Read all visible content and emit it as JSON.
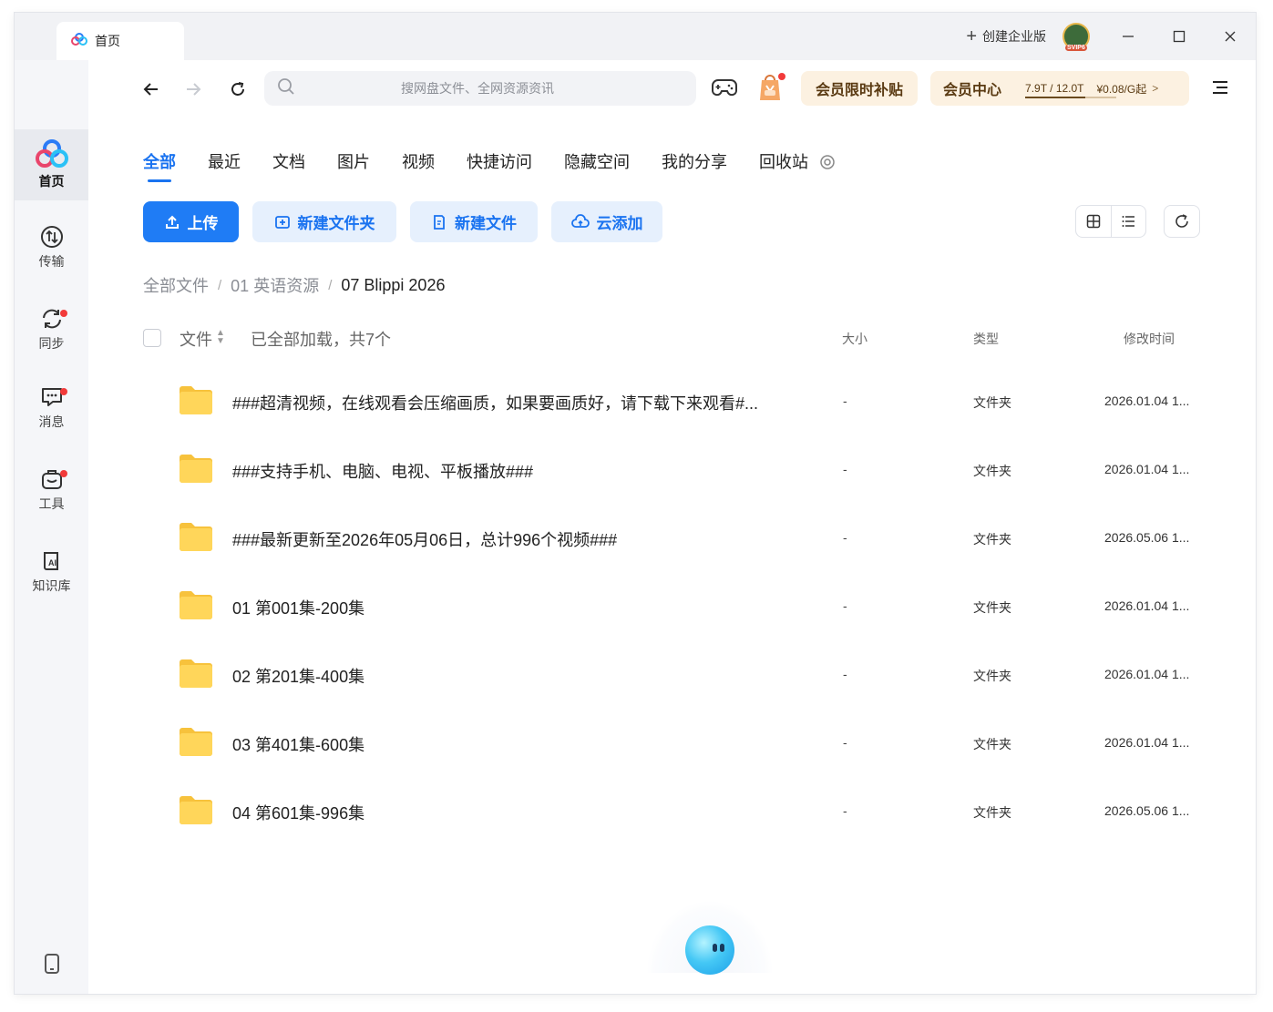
{
  "titlebar": {
    "tab_label": "首页",
    "enterprise_label": "创建企业版",
    "avatar_badge": "SVIP6"
  },
  "sidebar": {
    "items": [
      {
        "label": "首页",
        "icon": "baidu-netdisk-logo-icon",
        "active": true
      },
      {
        "label": "传输",
        "icon": "transfer-icon",
        "badge": false
      },
      {
        "label": "同步",
        "icon": "sync-icon",
        "badge": true
      },
      {
        "label": "消息",
        "icon": "message-icon",
        "badge": true
      },
      {
        "label": "工具",
        "icon": "toolbox-icon",
        "badge": true
      },
      {
        "label": "知识库",
        "icon": "knowledge-base-icon",
        "badge": false
      }
    ]
  },
  "toolbar": {
    "search_placeholder": "搜网盘文件、全网资源资讯",
    "promo_label": "会员限时补贴",
    "vip_label": "会员中心",
    "storage_text": "7.9T / 12.0T",
    "storage_used_fraction": 0.66,
    "price_text": "¥0.08/G起",
    "price_chevron": ">"
  },
  "tabs": [
    "全部",
    "最近",
    "文档",
    "图片",
    "视频",
    "快捷访问",
    "隐藏空间",
    "我的分享",
    "回收站"
  ],
  "actions": {
    "upload": "上传",
    "new_folder": "新建文件夹",
    "new_file": "新建文件",
    "cloud_add": "云添加"
  },
  "breadcrumb": {
    "items": [
      "全部文件",
      "01 英语资源"
    ],
    "current": "07 Blippi 2026",
    "separator": "/"
  },
  "list": {
    "header": {
      "file": "文件",
      "loaded": "已全部加载，共7个",
      "size": "大小",
      "type": "类型",
      "modified": "修改时间"
    },
    "rows": [
      {
        "name": "###超清视频，在线观看会压缩画质，如果要画质好，请下载下来观看#...",
        "size": "-",
        "type": "文件夹",
        "date": "2026.01.04 1..."
      },
      {
        "name": "###支持手机、电脑、电视、平板播放###",
        "size": "-",
        "type": "文件夹",
        "date": "2026.01.04 1..."
      },
      {
        "name": "###最新更新至2026年05月06日，总计996个视频###",
        "size": "-",
        "type": "文件夹",
        "date": "2026.05.06 1..."
      },
      {
        "name": "01 第001集-200集",
        "size": "-",
        "type": "文件夹",
        "date": "2026.01.04 1..."
      },
      {
        "name": "02 第201集-400集",
        "size": "-",
        "type": "文件夹",
        "date": "2026.01.04 1..."
      },
      {
        "name": "03 第401集-600集",
        "size": "-",
        "type": "文件夹",
        "date": "2026.01.04 1..."
      },
      {
        "name": "04 第601集-996集",
        "size": "-",
        "type": "文件夹",
        "date": "2026.05.06 1..."
      }
    ]
  },
  "colors": {
    "accent": "#1f7cf5",
    "accent_light": "#e6f0fd",
    "vip_bg": "#fcf1e1",
    "vip_text": "#5a3a12",
    "badge_red": "#f23a3a",
    "folder_yellow": "#ffcf4a"
  }
}
